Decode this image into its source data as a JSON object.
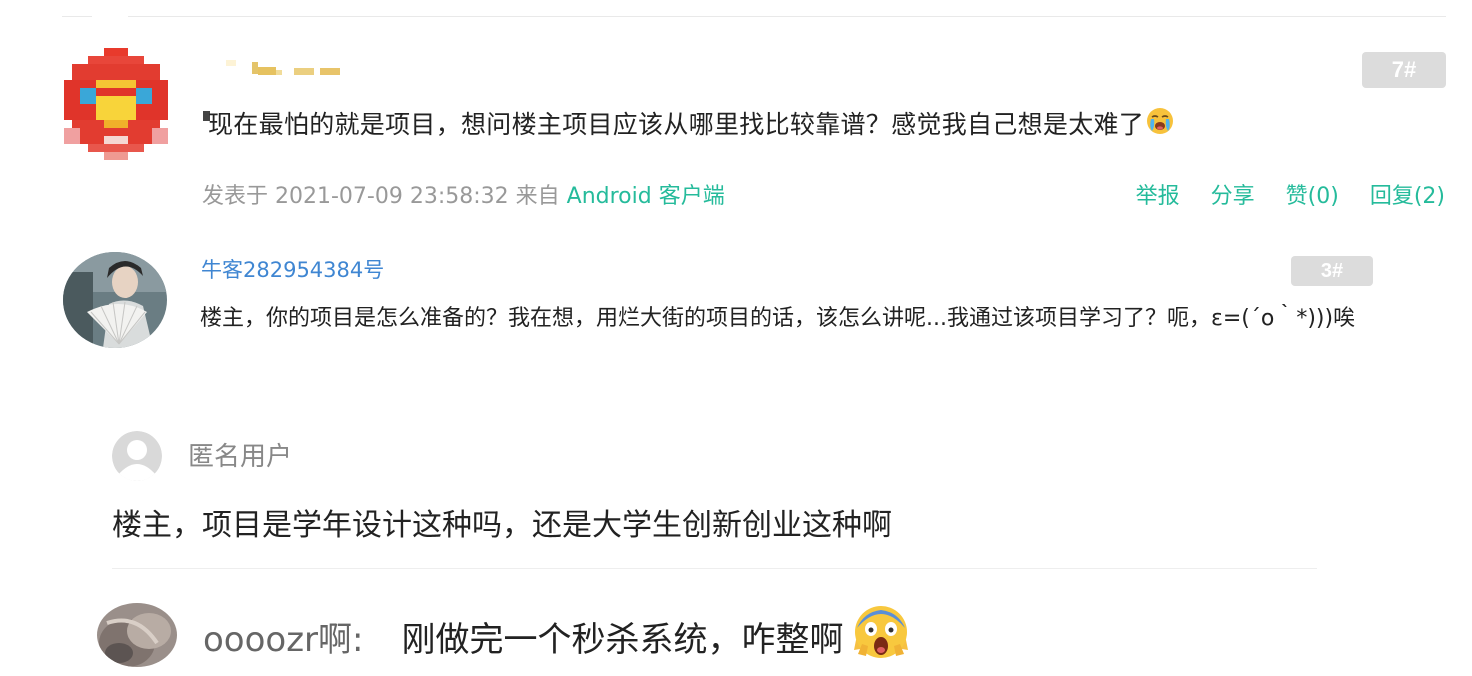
{
  "post": {
    "floor": "7#",
    "text": "现在最怕的就是项目，想问楼主项目应该从哪里找比较靠谱？感觉我自己想是太难了",
    "emoji_icon": "crying-face-icon",
    "meta_prefix": "发表于 2021-07-09 23:58:32  来自",
    "client": "Android 客户端",
    "actions": {
      "report": "举报",
      "share": "分享",
      "like": "赞(0)",
      "reply": "回复(2)"
    }
  },
  "reply": {
    "username": "牛客282954384号",
    "floor": "3#",
    "text": "楼主，你的项目是怎么准备的？我在想，用烂大街的项目的话，该怎么讲呢...我通过该项目学习了？呃，ε=(´ο｀*)))唉"
  },
  "anon_comment": {
    "username": "匿名用户",
    "text": "楼主，项目是学年设计这种吗，还是大学生创新创业这种啊"
  },
  "bottom_comment": {
    "username": "oooozr啊:",
    "text": "刚做完一个秒杀系统，咋整啊",
    "emoji_icon": "screaming-face-icon"
  },
  "colors": {
    "accent_green": "#25bb9b",
    "username_blue": "#3f86d2",
    "meta_gray": "#999999",
    "badge_gray": "#dcdcdc"
  }
}
